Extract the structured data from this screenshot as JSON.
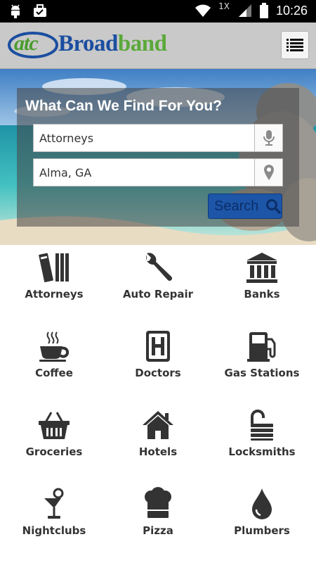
{
  "status_bar": {
    "time": "10:26",
    "signal_label": "1X",
    "left_icons": [
      "android-debug-icon",
      "briefcase-check-icon"
    ],
    "right_icons": [
      "wifi-icon",
      "signal-icon",
      "battery-icon"
    ]
  },
  "header": {
    "logo_atc": "atc",
    "logo_broad": "Broad",
    "logo_band": "band",
    "menu_icon": "list-menu-icon"
  },
  "search": {
    "title": "What Can We Find For You?",
    "what_value": "Attorneys",
    "where_value": "Alma, GA",
    "button_label": "Search",
    "colors": {
      "button": "#1d56a8",
      "panel": "rgba(70,70,70,0.55)"
    }
  },
  "categories": [
    {
      "label": "Attorneys",
      "icon": "books-icon"
    },
    {
      "label": "Auto Repair",
      "icon": "wrench-icon"
    },
    {
      "label": "Banks",
      "icon": "bank-icon"
    },
    {
      "label": "Coffee",
      "icon": "coffee-cup-icon"
    },
    {
      "label": "Doctors",
      "icon": "hospital-icon"
    },
    {
      "label": "Gas Stations",
      "icon": "gas-pump-icon"
    },
    {
      "label": "Groceries",
      "icon": "basket-icon"
    },
    {
      "label": "Hotels",
      "icon": "house-icon"
    },
    {
      "label": "Locksmiths",
      "icon": "padlock-icon"
    },
    {
      "label": "Nightclubs",
      "icon": "cocktail-icon"
    },
    {
      "label": "Pizza",
      "icon": "chef-hat-icon"
    },
    {
      "label": "Plumbers",
      "icon": "water-drop-icon"
    }
  ]
}
